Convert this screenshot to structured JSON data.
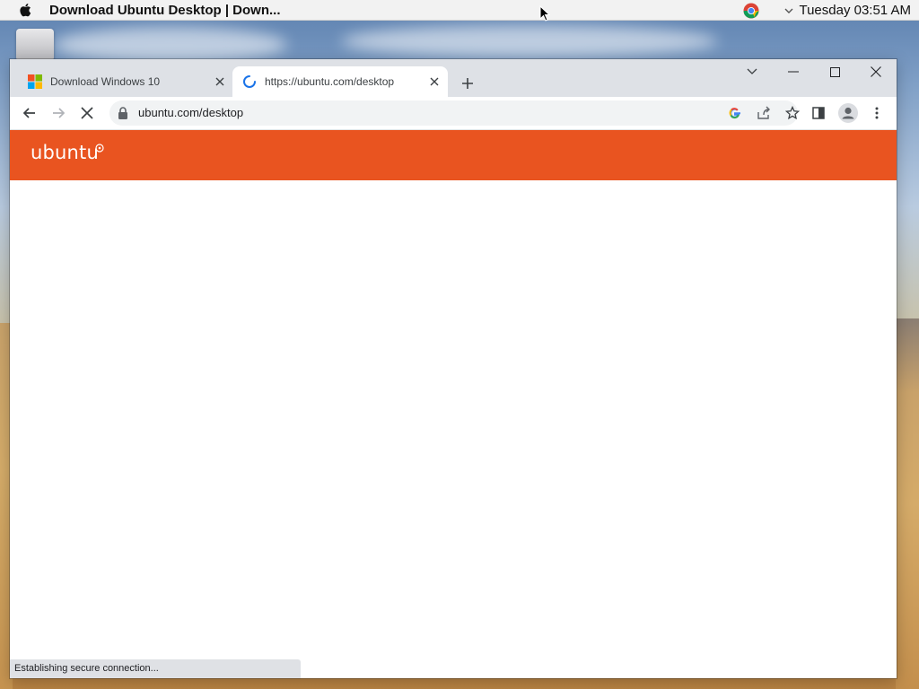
{
  "menubar": {
    "title": "Download Ubuntu Desktop | Down...",
    "clock": "Tuesday 03:51 AM"
  },
  "browser": {
    "tabs": [
      {
        "title": "Download Windows 10",
        "favicon": "windows-logo-icon",
        "active": false
      },
      {
        "title": "https://ubuntu.com/desktop",
        "favicon": "loading-spinner-icon",
        "active": true
      }
    ],
    "url": "ubuntu.com/desktop",
    "status": "Establishing secure connection..."
  },
  "page": {
    "logo_text": "ubuntu",
    "brand_color": "#e95420"
  }
}
